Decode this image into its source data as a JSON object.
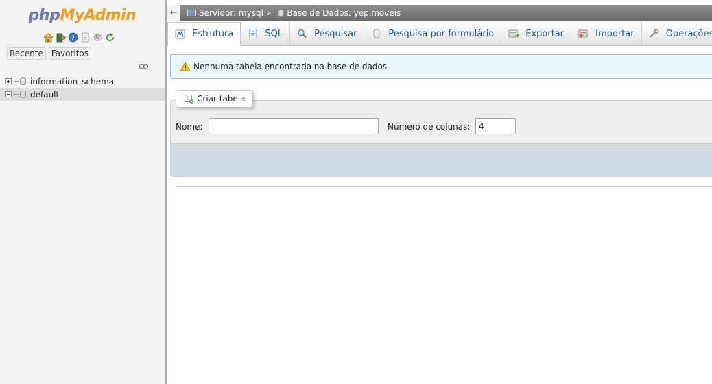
{
  "sidebar": {
    "logo_php": "php",
    "logo_myadmin": "MyAdmin",
    "icons": [
      "home-icon",
      "exit-icon",
      "help-icon",
      "docs-icon",
      "settings-icon",
      "reload-icon"
    ],
    "tab_recent": "Recente",
    "tab_favorites": "Favoritos",
    "databases": [
      {
        "name": "information_schema",
        "expanded": false,
        "selected": false
      },
      {
        "name": "default",
        "expanded": true,
        "selected": true
      }
    ]
  },
  "breadcrumb": {
    "back_label": "←",
    "server_label": "Servidor: mysql",
    "separator": "»",
    "database_label": "Base de Dados: yepimoveis"
  },
  "menu": {
    "tabs": [
      {
        "label": "Estrutura",
        "active": true
      },
      {
        "label": "SQL",
        "active": false
      },
      {
        "label": "Pesquisar",
        "active": false
      },
      {
        "label": "Pesquisa por formulário",
        "active": false
      },
      {
        "label": "Exportar",
        "active": false
      },
      {
        "label": "Importar",
        "active": false
      },
      {
        "label": "Operações",
        "active": false
      }
    ]
  },
  "notice": {
    "text": "Nenhuma tabela encontrada na base de dados."
  },
  "create_table": {
    "legend": "Criar tabela",
    "name_label": "Nome:",
    "name_value": "",
    "columns_label": "Número de colunas:",
    "columns_value": "4"
  },
  "colors": {
    "logo_php": "#6c78af",
    "logo_myadmin": "#f29c1f",
    "link_blue": "#235a81",
    "notice_bg": "#ebf8fd",
    "footer_bg": "#d2dbe3"
  }
}
